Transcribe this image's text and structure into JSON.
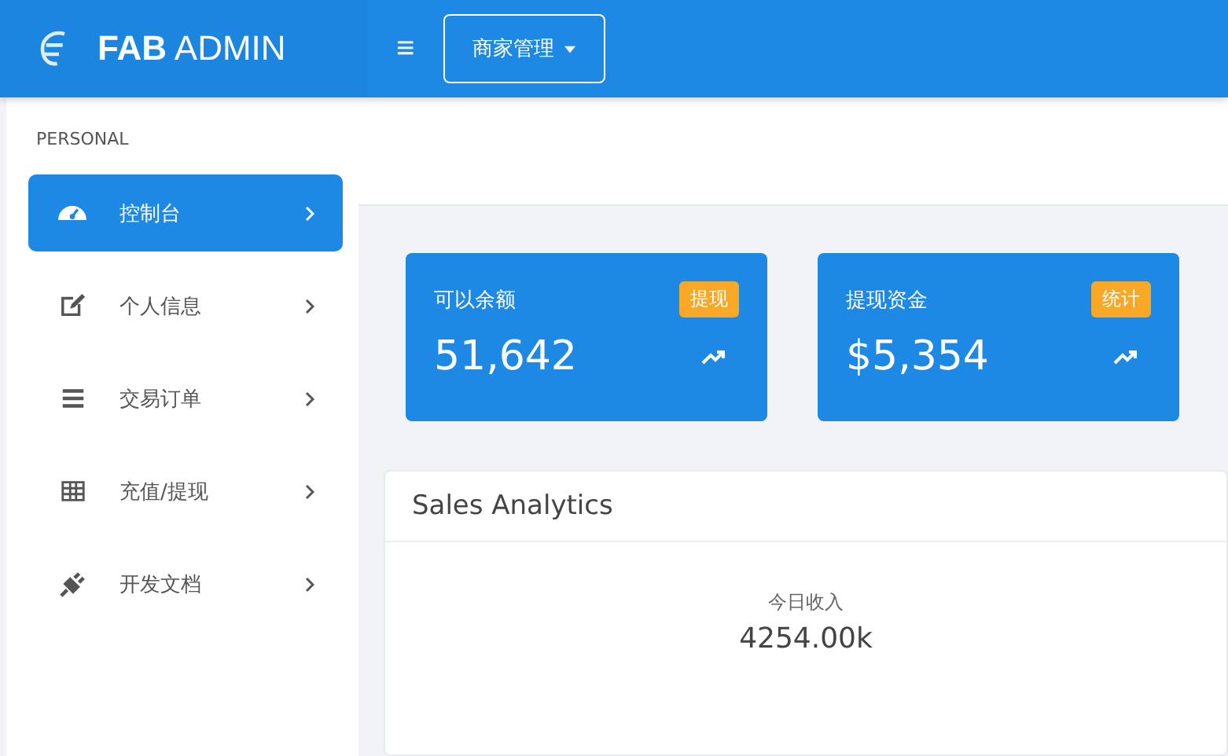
{
  "brand": {
    "bold": "FAB",
    "rest": "ADMIN"
  },
  "topbar": {
    "menu_icon": "≡",
    "dropdown": "商家管理"
  },
  "sidebar": {
    "heading": "PERSONAL",
    "items": [
      {
        "label": "控制台",
        "kind": "gauge",
        "selected": true
      },
      {
        "label": "个人信息",
        "kind": "edit",
        "selected": false
      },
      {
        "label": "交易订单",
        "kind": "bars",
        "selected": false
      },
      {
        "label": "充值/提现",
        "kind": "table",
        "selected": false
      },
      {
        "label": "开发文档",
        "kind": "plug",
        "selected": false
      }
    ]
  },
  "stats": [
    {
      "title": "可以余额",
      "badge": "提现",
      "value": "51,642"
    },
    {
      "title": "提现资金",
      "badge": "统计",
      "value": "$5,354"
    }
  ],
  "analytics": {
    "title": "Sales Analytics",
    "label": "今日收入",
    "value": "4254.00k"
  }
}
